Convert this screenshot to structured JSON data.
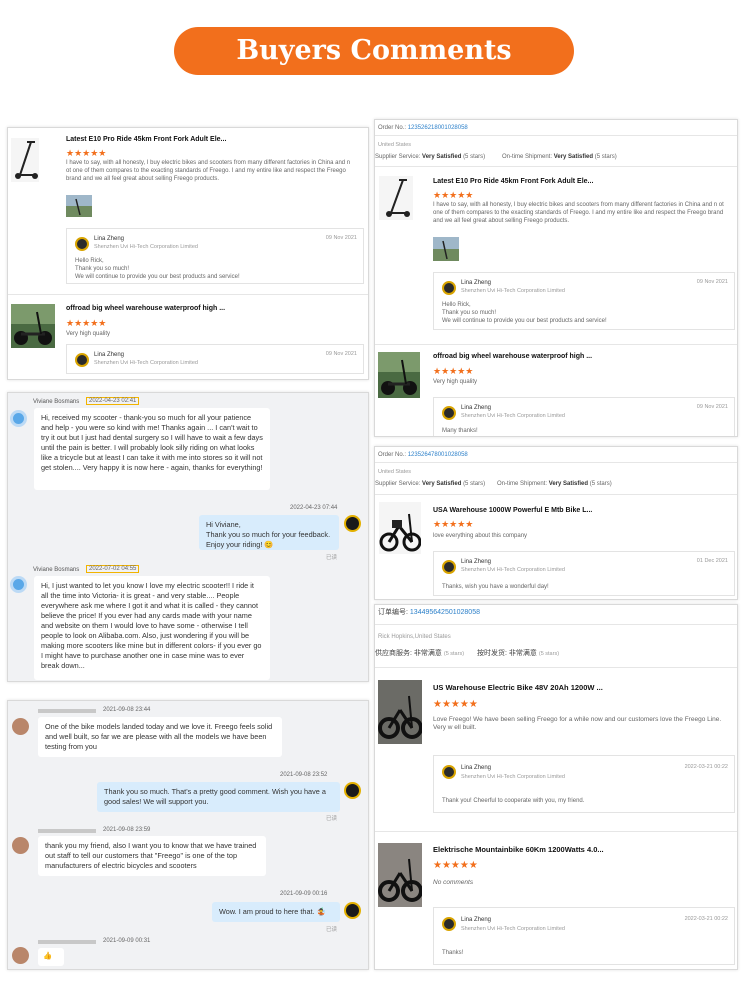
{
  "banner": {
    "title": "Buyers Comments"
  },
  "review_panel_1": {
    "items": [
      {
        "title": "Latest E10 Pro Ride 45km Front Fork Adult Ele...",
        "stars": "★★★★★",
        "text": "I have to say, with all honesty, I buy electric bikes and scooters from many different factories in China and n ot one of them compares to the exacting standards of Freego.  I and my entire like and respect the Freego brand and we all feel great about selling Freego products.",
        "seller": "Lina Zheng",
        "company": "Shenzhen Uvi Hi-Tech Corporation Limited",
        "date": "09 Nov 2021",
        "reply": [
          "Hello Rick,",
          "Thank you so much!",
          "We will continue to provide you our best products and service!"
        ]
      },
      {
        "title": "offroad big wheel warehouse waterproof high ...",
        "stars": "★★★★★",
        "text": "Very high quality",
        "seller": "Lina Zheng",
        "company": "Shenzhen Uvi Hi-Tech Corporation Limited",
        "date": "09 Nov 2021"
      }
    ]
  },
  "chat_panel_1": {
    "messages": [
      {
        "name": "Viviane Bosmans",
        "time": "2022-04-23 02:41",
        "text": "Hi, received my scooter - thank-you so much for all your patience and help - you were so kind with me! Thanks again ... I can't wait to try it out but I just had dental surgery so I will have to wait a few days until the pain is better. I will probably look silly riding on what looks like a tricycle but at least I can take it with me into stores so it will not get stolen.... Very happy it is now here - again, thanks for everything!"
      },
      {
        "time": "2022-04-23 07:44",
        "text": "Hi Viviane,\nThank you so much for your feedback. Enjoy your riding! 😊",
        "read": "已读"
      },
      {
        "name": "Viviane Bosmans",
        "time": "2022-07-02 04:55",
        "text": "Hi, I just wanted to let you know I love my electric scooter!! I ride it all the time into Victoria- it is great - and very stable.... People everywhere ask me where I got it and what it is called - they cannot believe the price! If you ever had any cards made with your name and website on them I would love to have some - otherwise I tell people to look on Alibaba.com. Also, just wondering if you will be making more scooters like mine but in different colors- if you ever go I might have to purchase another one in case mine was to ever break down..."
      }
    ]
  },
  "chat_panel_2": {
    "messages": [
      {
        "time": "2021-09-08 23:44",
        "text": "One of the bike models landed today and we love it. Freego feels solid and well built, so far we are please with all the models we have been testing from you"
      },
      {
        "time": "2021-09-08 23:52",
        "text": "Thank you so much. That's a pretty good comment. Wish you have a good sales! We will support you.",
        "read": "已读"
      },
      {
        "time": "2021-09-08 23:59",
        "text": "thank you my friend, also I want you to know that we have trained out staff to tell our customers that \"Freego\" is one of the top manufacturers of electric bicycles and scooters"
      },
      {
        "time": "2021-09-09 00:16",
        "text": "Wow. I am proud to here that. 🤹",
        "read": "已读"
      },
      {
        "time": "2021-09-09 00:31",
        "text": "👍"
      }
    ]
  },
  "order_panel_1": {
    "order_label": "Order No.:",
    "order_no": "123526218001028058",
    "country": "United States",
    "supplier_label": "Supplier Service:",
    "supplier_value": "Very Satisfied",
    "supplier_stars": "(5 stars)",
    "ship_label": "On-time Shipment:",
    "ship_value": "Very Satisfied",
    "ship_stars": "(5 stars)",
    "items": [
      {
        "title": "Latest E10 Pro Ride 45km Front Fork Adult Ele...",
        "stars": "★★★★★",
        "text": "I have to say, with all honesty, I buy electric bikes and scooters from many different factories in China and n ot one of them compares to the exacting standards of Freego.  I and my entire like and respect the Freego brand and we all feel great about selling Freego products.",
        "seller": "Lina Zheng",
        "company": "Shenzhen Uvi Hi-Tech Corporation Limited",
        "date": "09 Nov 2021",
        "reply": [
          "Hello Rick,",
          "Thank you so much!",
          "We will continue to provide you our best products and service!"
        ]
      },
      {
        "title": "offroad big wheel warehouse waterproof high ...",
        "stars": "★★★★★",
        "text": "Very high quality",
        "seller": "Lina Zheng",
        "company": "Shenzhen Uvi Hi-Tech Corporation Limited",
        "date": "09 Nov 2021",
        "reply": [
          "Many thanks!"
        ]
      }
    ]
  },
  "order_panel_2": {
    "order_label": "Order No.:",
    "order_no": "123526478001028058",
    "country": "United States",
    "supplier_label": "Supplier Service:",
    "supplier_value": "Very Satisfied",
    "supplier_stars": "(5 stars)",
    "ship_label": "On-time Shipment:",
    "ship_value": "Very Satisfied",
    "ship_stars": "(5 stars)",
    "item": {
      "title": "USA Warehouse 1000W Powerful E Mtb Bike L...",
      "stars": "★★★★★",
      "text": "love everything about this company",
      "seller": "Lina Zheng",
      "company": "Shenzhen Uvi Hi-Tech Corporation Limited",
      "date": "01 Dec 2021",
      "reply": "Thanks, wish you have a wonderful day!"
    }
  },
  "order_panel_3": {
    "order_label": "订单编号:",
    "order_no": "134495642501028058",
    "buyer": "Rick Hopkins,United States",
    "supplier_label": "供应商服务:",
    "supplier_value": "非常满意",
    "supplier_stars": "(5 stars)",
    "ship_label": "按时发货:",
    "ship_value": "非常满意",
    "ship_stars": "(5 stars)",
    "items": [
      {
        "title": "US Warehouse Electric Bike 48V 20Ah 1200W ...",
        "stars": "★★★★★",
        "text": "Love Freego! We have been selling Freego for a while now and our customers love the Freego Line.  Very w ell built.",
        "seller": "Lina Zheng",
        "company": "Shenzhen Uvi Hi-Tech Corporation Limited",
        "date": "2022-03-21 00:22",
        "reply": "Thank you! Cheerful to cooperate with you, my friend."
      },
      {
        "title": "Elektrische Mountainbike 60Km 1200Watts 4.0...",
        "stars": "★★★★★",
        "text": "No comments",
        "seller": "Lina Zheng",
        "company": "Shenzhen Uvi Hi-Tech Corporation Limited",
        "date": "2022-03-21 00:22",
        "reply": "Thanks!"
      }
    ]
  }
}
